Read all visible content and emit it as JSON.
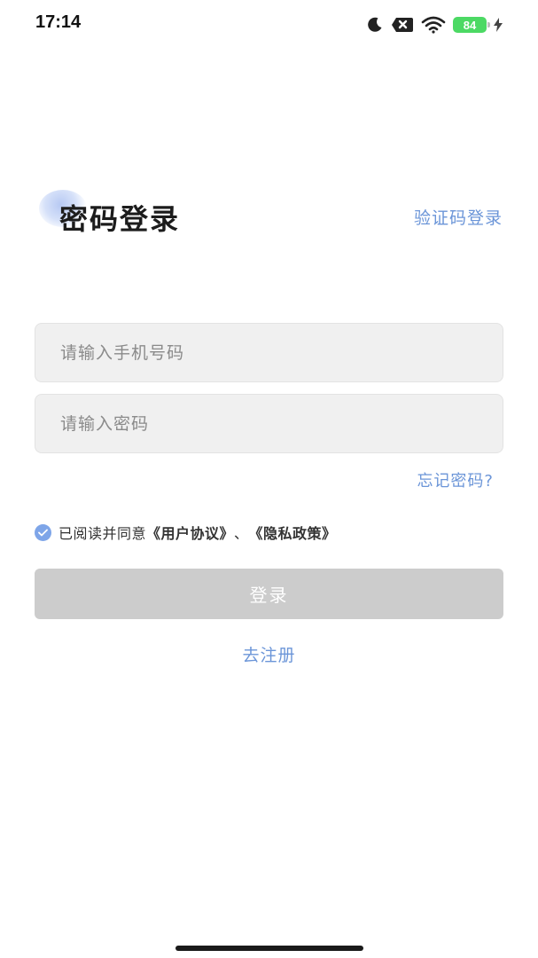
{
  "status_bar": {
    "time": "17:14",
    "battery_level": "84",
    "icons": [
      "moon-icon",
      "mute-icon",
      "wifi-icon",
      "battery-icon",
      "charging-icon"
    ]
  },
  "header": {
    "title": "密码登录",
    "switch_mode_label": "验证码登录"
  },
  "form": {
    "phone_placeholder": "请输入手机号码",
    "password_placeholder": "请输入密码",
    "forgot_label": "忘记密码?"
  },
  "agreement": {
    "checked": true,
    "prefix": "已阅读并同意",
    "user_agreement": "《用户协议》",
    "separator": "、",
    "privacy_policy": "《隐私政策》"
  },
  "actions": {
    "login_label": "登录",
    "register_label": "去注册"
  },
  "colors": {
    "accent": "#6b95d8",
    "checkbox": "#7ea5e8",
    "button_disabled": "#cccccc",
    "input_bg": "#f0f0f0"
  }
}
